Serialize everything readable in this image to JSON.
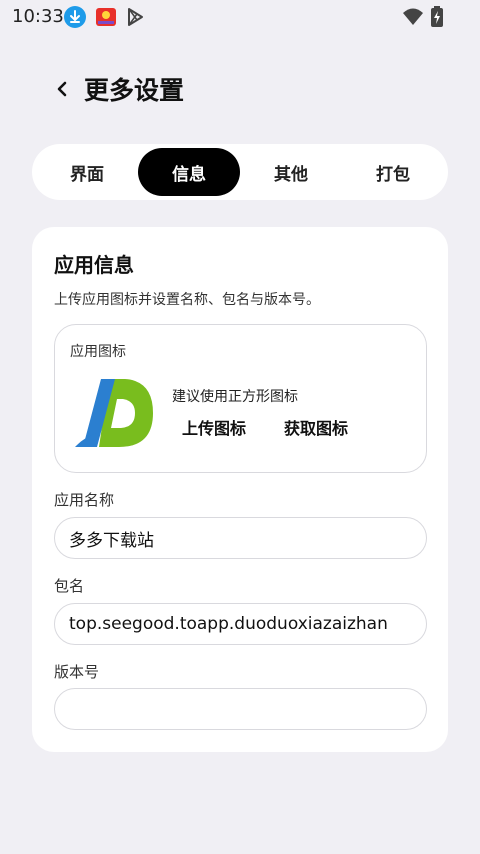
{
  "status_bar": {
    "time": "10:33",
    "icons": [
      "download-icon",
      "app-notification-icon",
      "play-store-icon",
      "wifi-icon",
      "battery-icon"
    ],
    "download_color": "#1e9be9"
  },
  "header": {
    "back_icon": "chevron-left-icon",
    "title": "更多设置"
  },
  "tabs": [
    {
      "label": "界面",
      "active": false
    },
    {
      "label": "信息",
      "active": true
    },
    {
      "label": "其他",
      "active": false
    },
    {
      "label": "打包",
      "active": false
    }
  ],
  "app_info": {
    "title": "应用信息",
    "description": "上传应用图标并设置名称、包名与版本号。",
    "icon_section": {
      "label": "应用图标",
      "hint": "建议使用正方形图标",
      "upload_label": "上传图标",
      "fetch_label": "获取图标",
      "icon_name": "app-logo-icon",
      "icon_colors": {
        "blue": "#2b7fd0",
        "green": "#79bd1e"
      }
    },
    "name": {
      "label": "应用名称",
      "value": "多多下载站",
      "placeholder": ""
    },
    "package": {
      "label": "包名",
      "value": "top.seegood.toapp.duoduoxiazaizhan",
      "placeholder": ""
    },
    "version": {
      "label": "版本号",
      "value": "",
      "placeholder": ""
    }
  },
  "theme": {
    "background": "#f0eff4",
    "card": "#ffffff",
    "active_tab": "#000000"
  }
}
